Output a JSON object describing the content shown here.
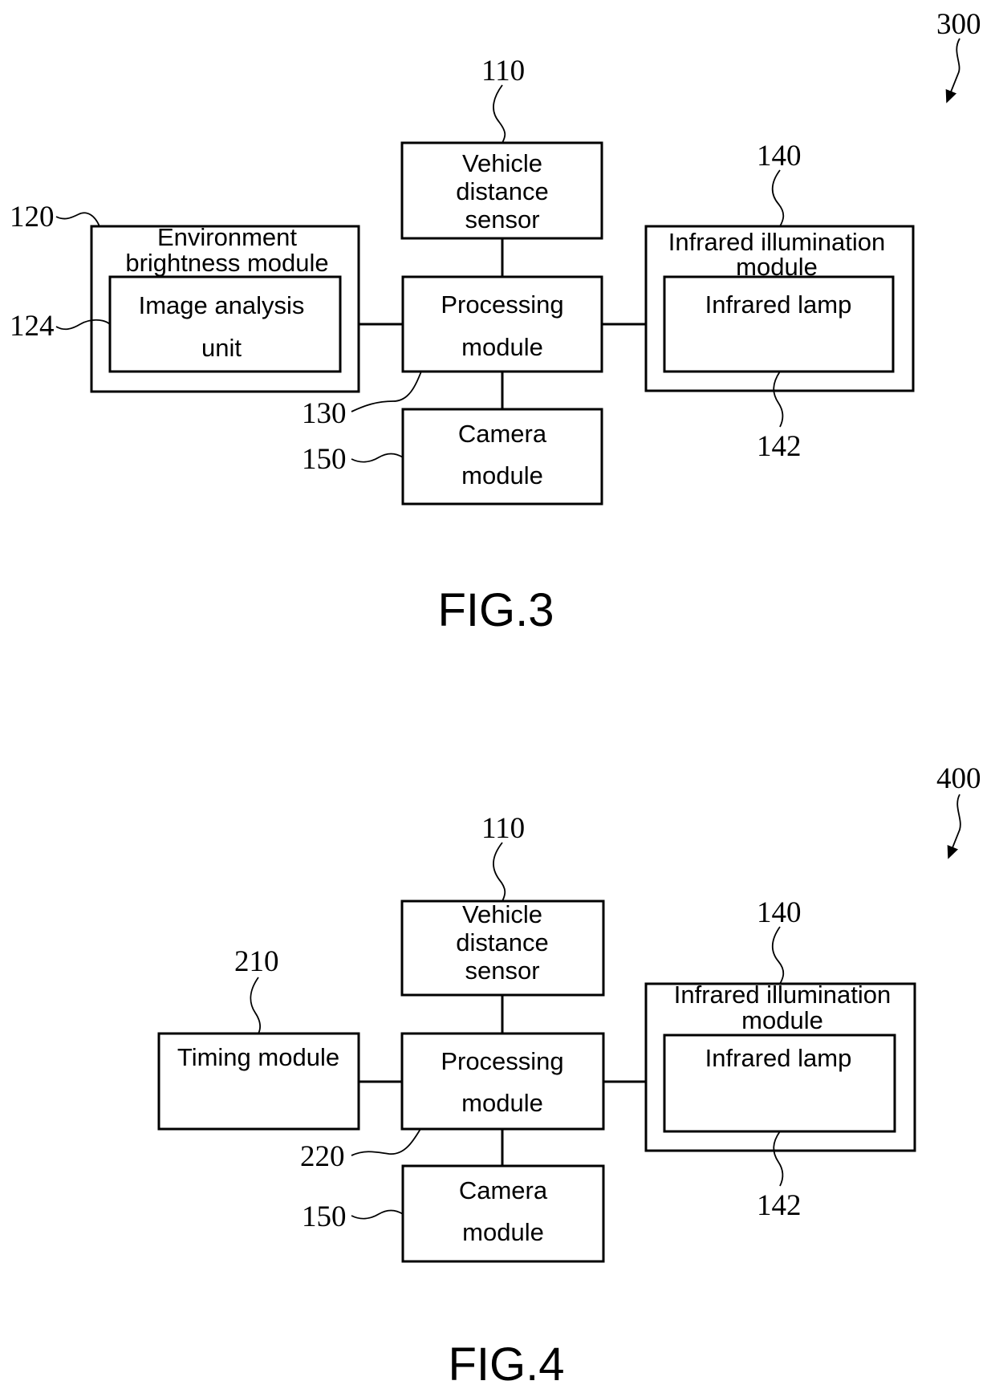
{
  "figures": [
    {
      "caption": "FIG.3",
      "system_ref": "300",
      "blocks": {
        "vehicle_sensor": {
          "ref": "110",
          "lines": [
            "Vehicle",
            "distance",
            "sensor"
          ]
        },
        "environment": {
          "ref": "120",
          "lines": [
            "Environment",
            "brightness module"
          ]
        },
        "image_analysis": {
          "ref": "124",
          "lines": [
            "Image analysis",
            "unit"
          ]
        },
        "processing": {
          "ref": "130",
          "lines": [
            "Processing",
            "module"
          ]
        },
        "infrared_module": {
          "ref": "140",
          "lines": [
            "Infrared illumination",
            "module"
          ]
        },
        "infrared_lamp": {
          "ref": "142",
          "lines": [
            "Infrared lamp"
          ]
        },
        "camera": {
          "ref": "150",
          "lines": [
            "Camera",
            "module"
          ]
        }
      }
    },
    {
      "caption": "FIG.4",
      "system_ref": "400",
      "blocks": {
        "vehicle_sensor": {
          "ref": "110",
          "lines": [
            "Vehicle",
            "distance",
            "sensor"
          ]
        },
        "timing": {
          "ref": "210",
          "lines": [
            "Timing module"
          ]
        },
        "processing": {
          "ref": "220",
          "lines": [
            "Processing",
            "module"
          ]
        },
        "infrared_module": {
          "ref": "140",
          "lines": [
            "Infrared illumination",
            "module"
          ]
        },
        "infrared_lamp": {
          "ref": "142",
          "lines": [
            "Infrared lamp"
          ]
        },
        "camera": {
          "ref": "150",
          "lines": [
            "Camera",
            "module"
          ]
        }
      }
    }
  ]
}
